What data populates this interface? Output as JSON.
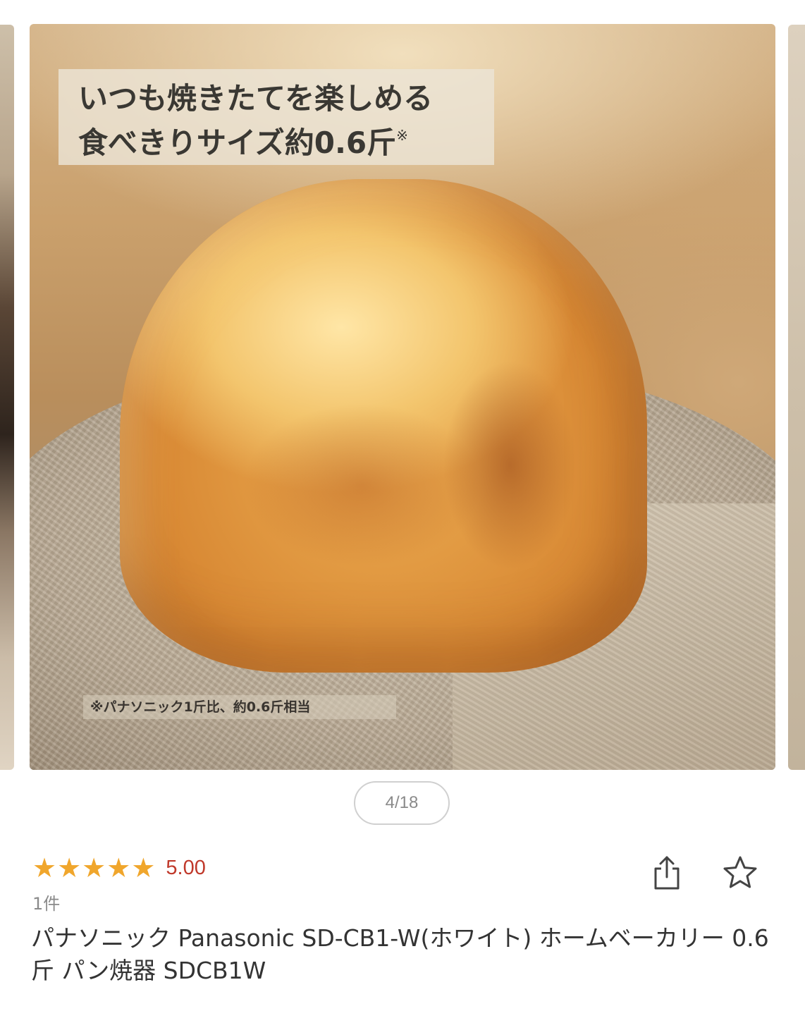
{
  "carousel": {
    "counter": "4/18",
    "slide": {
      "caption_line1": "いつも焼きたてを楽しめる",
      "caption_line2": "食べきりサイズ約0.6斤",
      "caption_mark": "※",
      "footnote": "※パナソニック1斤比、約0.6斤相当"
    }
  },
  "product": {
    "rating_value": "5.00",
    "stars": 5,
    "review_count": "1件",
    "title": "パナソニック Panasonic SD-CB1-W(ホワイト) ホームベーカリー 0.6斤 パン焼器 SDCB1W"
  },
  "colors": {
    "star": "#f0a62c",
    "rating_value": "#c0392b",
    "title": "#333333",
    "muted": "#8a8a8a"
  },
  "icons": {
    "share": "share-icon",
    "favorite": "star-outline-icon",
    "rating_star": "star-filled-icon"
  }
}
